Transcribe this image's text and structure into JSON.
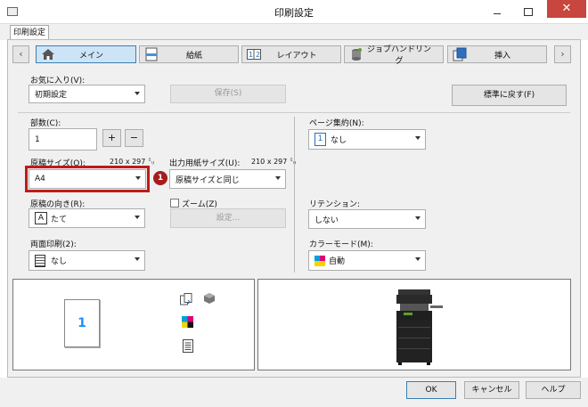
{
  "window": {
    "title": "印刷設定",
    "close_symbol": "✕"
  },
  "tabs": [
    {
      "label": "印刷設定"
    }
  ],
  "nav": {
    "prev_symbol": "‹",
    "next_symbol": "›",
    "items": [
      {
        "label": "メイン",
        "icon": "home-icon",
        "active": true
      },
      {
        "label": "給紙",
        "icon": "paper-tray-icon"
      },
      {
        "label": "レイアウト",
        "icon": "layout-icon"
      },
      {
        "label": "ジョブハンドリング",
        "icon": "job-handling-icon"
      },
      {
        "label": "挿入",
        "icon": "insert-icon"
      }
    ]
  },
  "favorites": {
    "label": "お気に入り(V):",
    "value": "初期設定",
    "save_label": "保存(S)",
    "reset_label": "標準に戻す(F)"
  },
  "copies": {
    "label": "部数(C):",
    "value": "1",
    "plus": "+",
    "minus": "−"
  },
  "original_size": {
    "label": "原稿サイズ(O):",
    "dims": "210 x 297 ㍉",
    "value": "A4",
    "callout": "1"
  },
  "output_size": {
    "label": "出力用紙サイズ(U):",
    "dims": "210 x 297 ㍉",
    "value": "原稿サイズと同じ"
  },
  "orientation": {
    "label": "原稿の向き(R):",
    "value": "たて",
    "icon_letter": "A"
  },
  "zoom": {
    "label": "ズーム(Z)",
    "settings_label": "設定..."
  },
  "duplex": {
    "label": "両面印刷(2):",
    "value": "なし"
  },
  "nup": {
    "label": "ページ集約(N):",
    "value": "なし",
    "icon_number": "1"
  },
  "retention": {
    "label": "リテンション:",
    "value": "しない"
  },
  "color_mode": {
    "label": "カラーモード(M):",
    "value": "自動"
  },
  "preview": {
    "page_number": "1"
  },
  "buttons": {
    "ok": "OK",
    "cancel": "キャンセル",
    "help": "ヘルプ"
  },
  "colors": {
    "callout": "#a61c1c",
    "highlight_border": "#c01a1a",
    "active_nav": "#cde4f7",
    "page_number": "#1e90ff"
  }
}
